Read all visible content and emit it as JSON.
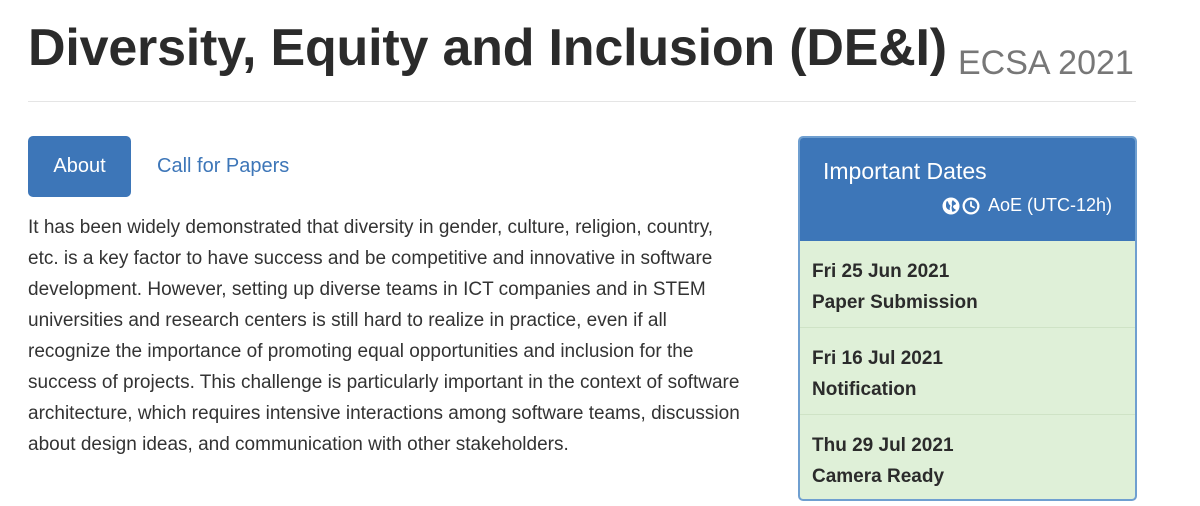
{
  "header": {
    "title": "Diversity, Equity and Inclusion (DE&I)",
    "conference": "ECSA 2021"
  },
  "tabs": [
    {
      "label": "About",
      "active": true
    },
    {
      "label": "Call for Papers",
      "active": false
    }
  ],
  "about": {
    "text": "It has been widely demonstrated that diversity in gender, culture, religion, country, etc. is a key factor to have success and be competitive and innovative in software development. However, setting up diverse teams in ICT companies and in STEM universities and research centers is still hard to realize in practice, even if all recognize the importance of promoting equal opportunities and inclusion for the success of projects. This challenge is particularly important in the context of software architecture, which requires intensive interactions among software teams, discussion about design ideas, and communication with other stakeholders."
  },
  "important_dates": {
    "title": "Important Dates",
    "timezone": "AoE (UTC-12h)",
    "icons": [
      "globe-icon",
      "clock-icon"
    ],
    "items": [
      {
        "date": "Fri 25 Jun 2021",
        "label": "Paper Submission"
      },
      {
        "date": "Fri 16 Jul 2021",
        "label": "Notification"
      },
      {
        "date": "Thu 29 Jul 2021",
        "label": "Camera Ready"
      }
    ]
  },
  "colors": {
    "primary": "#3d76b8",
    "panel_bg": "#dff0d8",
    "text": "#333333",
    "muted": "#777777"
  }
}
